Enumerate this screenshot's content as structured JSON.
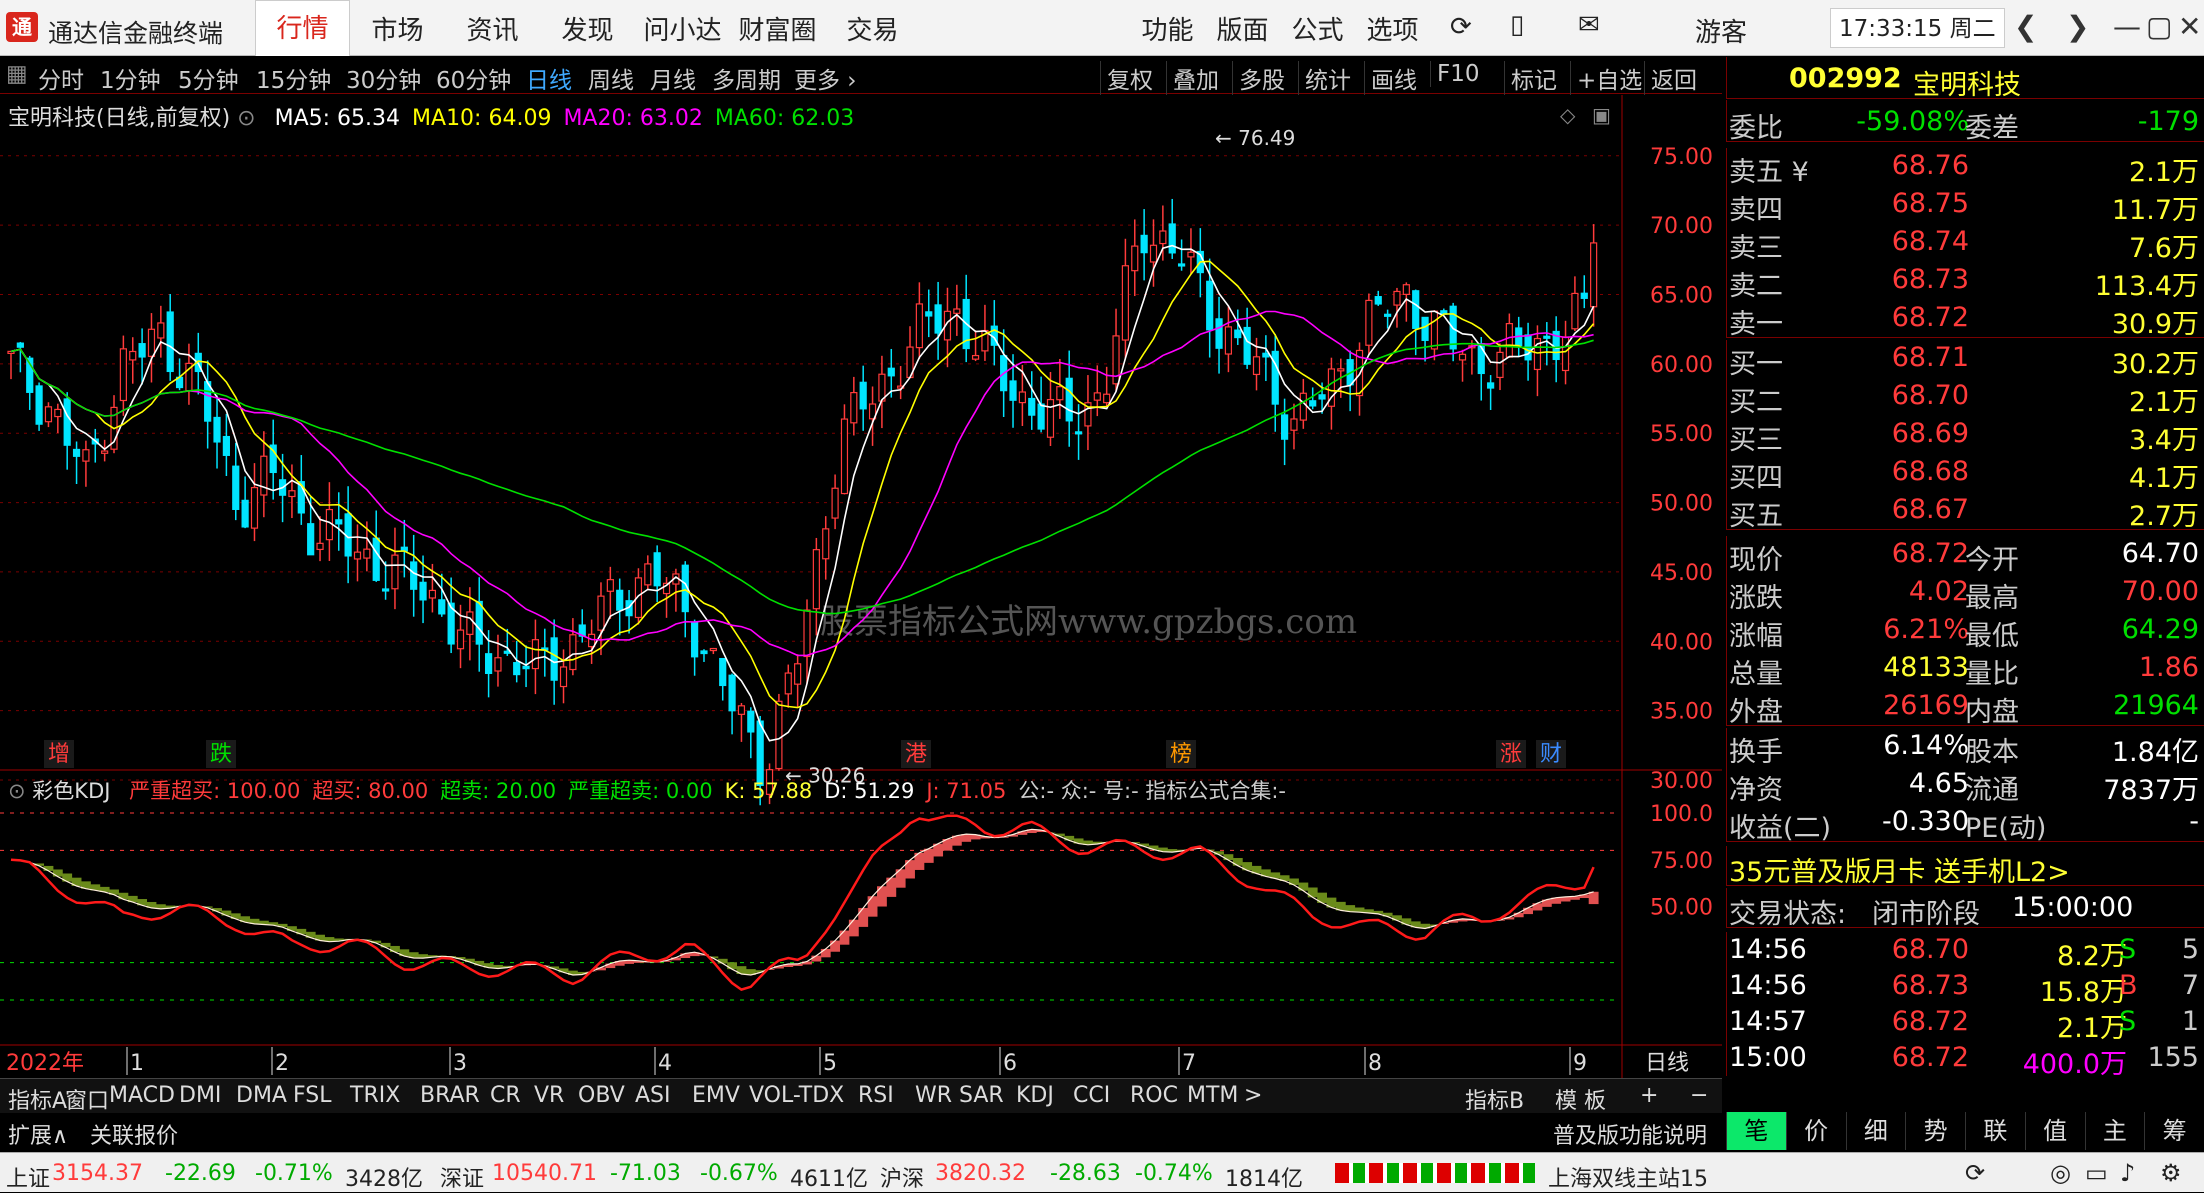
{
  "app": {
    "title": "通达信金融终端",
    "logo": "通",
    "active_tab": "行情",
    "top_tabs": [
      "行情",
      "市场",
      "资讯",
      "发现",
      "问小达",
      "财富圈",
      "交易"
    ],
    "right_menu": [
      "功能",
      "版面",
      "公式",
      "选项"
    ],
    "user": "游客",
    "clock": "17:33:15 周二"
  },
  "period_tabs": [
    "分时",
    "1分钟",
    "5分钟",
    "15分钟",
    "30分钟",
    "60分钟",
    "日线",
    "周线",
    "月线",
    "多周期",
    "更多"
  ],
  "active_period": "日线",
  "chart_tools": [
    "复权",
    "叠加",
    "多股",
    "统计",
    "画线",
    "F10",
    "标记",
    "+自选",
    "返回"
  ],
  "stock": {
    "code": "002992",
    "name": "宝明科技"
  },
  "main_chart": {
    "title": "宝明科技(日线,前复权)",
    "ma": [
      {
        "label": "MA5: 65.34",
        "color": "#ffffff"
      },
      {
        "label": "MA10: 64.09",
        "color": "#ffff00"
      },
      {
        "label": "MA20: 63.02",
        "color": "#ff00ff"
      },
      {
        "label": "MA60: 62.03",
        "color": "#00e000"
      }
    ],
    "high_label": "76.49",
    "low_label": "30.26",
    "markers": [
      {
        "t": "增",
        "c": "#ff3b3b"
      },
      {
        "t": "跌",
        "c": "#00e000"
      },
      {
        "t": "港",
        "c": "#ff3b3b"
      },
      {
        "t": "榜",
        "c": "#ff9900"
      },
      {
        "t": "涨",
        "c": "#ff3b3b"
      },
      {
        "t": "财",
        "c": "#3b8bff"
      }
    ],
    "watermark": "股票指标公式网www.gpzbgs.com",
    "y_ticks": [
      "75.00",
      "70.00",
      "65.00",
      "60.00",
      "55.00",
      "50.00",
      "45.00",
      "40.00",
      "35.00",
      "30.00"
    ]
  },
  "chart_data": [
    {
      "type": "candlestick",
      "title": "宝明科技(日线,前复权)",
      "x": [
        "2022-01",
        "2022-02",
        "2022-03",
        "2022-04",
        "2022-05",
        "2022-06",
        "2022-07",
        "2022-08",
        "2022-09"
      ],
      "ylim": [
        30,
        76.49
      ],
      "grid": true,
      "series": [
        {
          "name": "MA5",
          "last": 65.34
        },
        {
          "name": "MA10",
          "last": 64.09
        },
        {
          "name": "MA20",
          "last": 63.02
        },
        {
          "name": "MA60",
          "last": 62.03
        }
      ],
      "approx_close_path": [
        60,
        57,
        52,
        60,
        62,
        58,
        50,
        52,
        48,
        47,
        45,
        44,
        40,
        39,
        38,
        40,
        43,
        45,
        42,
        36,
        31,
        40,
        55,
        58,
        62,
        64,
        60,
        57,
        56,
        58,
        70,
        68,
        63,
        60,
        56,
        58,
        63,
        65,
        62,
        60,
        61,
        62,
        64
      ]
    },
    {
      "type": "line",
      "title": "彩色KDJ",
      "ylim": [
        0,
        100
      ],
      "reference_lines": [
        100,
        80,
        20,
        0
      ],
      "series": [
        {
          "name": "K",
          "last": 57.88
        },
        {
          "name": "D",
          "last": 51.29
        },
        {
          "name": "J",
          "last": 71.05
        }
      ]
    }
  ],
  "kdj": {
    "title": "彩色KDJ",
    "items": [
      {
        "t": "严重超买: 100.00",
        "c": "#ff3b3b"
      },
      {
        "t": "超买: 80.00",
        "c": "#ff3b3b"
      },
      {
        "t": "超卖: 20.00",
        "c": "#00e000"
      },
      {
        "t": "严重超卖: 0.00",
        "c": "#00e000"
      },
      {
        "t": "K: 57.88",
        "c": "#ffff33"
      },
      {
        "t": "D: 51.29",
        "c": "#ffffff"
      },
      {
        "t": "J: 71.05",
        "c": "#ff3b3b"
      },
      {
        "t": "公:- 众:- 号:- 指标公式合集:-",
        "c": "#cccccc"
      }
    ],
    "y_ticks": [
      "100.0",
      "75.00",
      "50.00"
    ]
  },
  "x_axis": {
    "year": "2022年",
    "months": [
      "1",
      "2",
      "3",
      "4",
      "5",
      "6",
      "7",
      "8",
      "9"
    ],
    "period_label": "日线"
  },
  "indicator_tabs": [
    "指标A",
    "窗口",
    "MACD",
    "DMI",
    "DMA",
    "FSL",
    "TRIX",
    "BRAR",
    "CR",
    "VR",
    "OBV",
    "ASI",
    "EMV",
    "VOL-TDX",
    "RSI",
    "WR",
    "SAR",
    "KDJ",
    "CCI",
    "ROC",
    "MTM",
    ">",
    "指标B",
    "模 板",
    "+",
    "−"
  ],
  "ext_bar": {
    "expand": "扩展∧",
    "related": "关联报价",
    "func": "普及版功能说明"
  },
  "order_book": {
    "wei": {
      "label1": "委比",
      "v1": "-59.08%",
      "label2": "委差",
      "v2": "-179"
    },
    "sell": [
      {
        "l": "卖五",
        "p": "68.76",
        "q": "2.1万"
      },
      {
        "l": "卖四",
        "p": "68.75",
        "q": "11.7万"
      },
      {
        "l": "卖三",
        "p": "68.74",
        "q": "7.6万"
      },
      {
        "l": "卖二",
        "p": "68.73",
        "q": "113.4万"
      },
      {
        "l": "卖一",
        "p": "68.72",
        "q": "30.9万"
      }
    ],
    "buy": [
      {
        "l": "买一",
        "p": "68.71",
        "q": "30.2万"
      },
      {
        "l": "买二",
        "p": "68.70",
        "q": "2.1万"
      },
      {
        "l": "买三",
        "p": "68.69",
        "q": "3.4万"
      },
      {
        "l": "买四",
        "p": "68.68",
        "q": "4.1万"
      },
      {
        "l": "买五",
        "p": "68.67",
        "q": "2.7万"
      }
    ]
  },
  "quote": [
    {
      "l1": "现价",
      "v1": "68.72",
      "c1": "#ff3b3b",
      "l2": "今开",
      "v2": "64.70",
      "c2": "#ffffff"
    },
    {
      "l1": "涨跌",
      "v1": "4.02",
      "c1": "#ff3b3b",
      "l2": "最高",
      "v2": "70.00",
      "c2": "#ff3b3b"
    },
    {
      "l1": "涨幅",
      "v1": "6.21%",
      "c1": "#ff3b3b",
      "l2": "最低",
      "v2": "64.29",
      "c2": "#00e000"
    },
    {
      "l1": "总量",
      "v1": "48133",
      "c1": "#ffff33",
      "l2": "量比",
      "v2": "1.86",
      "c2": "#ff3b3b"
    },
    {
      "l1": "外盘",
      "v1": "26169",
      "c1": "#ff3b3b",
      "l2": "内盘",
      "v2": "21964",
      "c2": "#00e000"
    }
  ],
  "fundamentals": [
    {
      "l1": "换手",
      "v1": "6.14%",
      "l2": "股本",
      "v2": "1.84亿"
    },
    {
      "l1": "净资",
      "v1": "4.65",
      "l2": "流通",
      "v2": "7837万"
    },
    {
      "l1": "收益(二)",
      "v1": "-0.330",
      "l2": "PE(动)",
      "v2": "-"
    }
  ],
  "promo": "35元普及版月卡 送手机L2>",
  "trade_status": {
    "label": "交易状态:",
    "state": "闭市阶段",
    "time": "15:00:00"
  },
  "ticks": [
    {
      "t": "14:56",
      "p": "68.70",
      "v": "8.2万",
      "bs": "S",
      "n": "5",
      "vc": "#ffff33",
      "bc": "#00e000"
    },
    {
      "t": "14:56",
      "p": "68.73",
      "v": "15.8万",
      "bs": "B",
      "n": "7",
      "vc": "#ffff33",
      "bc": "#ff3b3b"
    },
    {
      "t": "14:57",
      "p": "68.72",
      "v": "2.1万",
      "bs": "S",
      "n": "1",
      "vc": "#ffff33",
      "bc": "#00e000"
    },
    {
      "t": "15:00",
      "p": "68.72",
      "v": "400.0万",
      "bs": "",
      "n": "155",
      "vc": "#ff00ff",
      "bc": "#cccccc"
    }
  ],
  "right_tabs": [
    "笔",
    "价",
    "细",
    "势",
    "联",
    "值",
    "主",
    "筹"
  ],
  "status": {
    "sh": {
      "name": "上证",
      "v": "3154.37",
      "chg": "-22.69",
      "pct": "-0.71%",
      "amt": "3428亿"
    },
    "sz": {
      "name": "深证",
      "v": "10540.71",
      "chg": "-71.03",
      "pct": "-0.67%",
      "amt": "4611亿"
    },
    "hs": {
      "name": "沪深",
      "v": "3820.32",
      "chg": "-28.63",
      "pct": "-0.74%",
      "amt": "1814亿"
    },
    "server": "上海双线主站15"
  }
}
